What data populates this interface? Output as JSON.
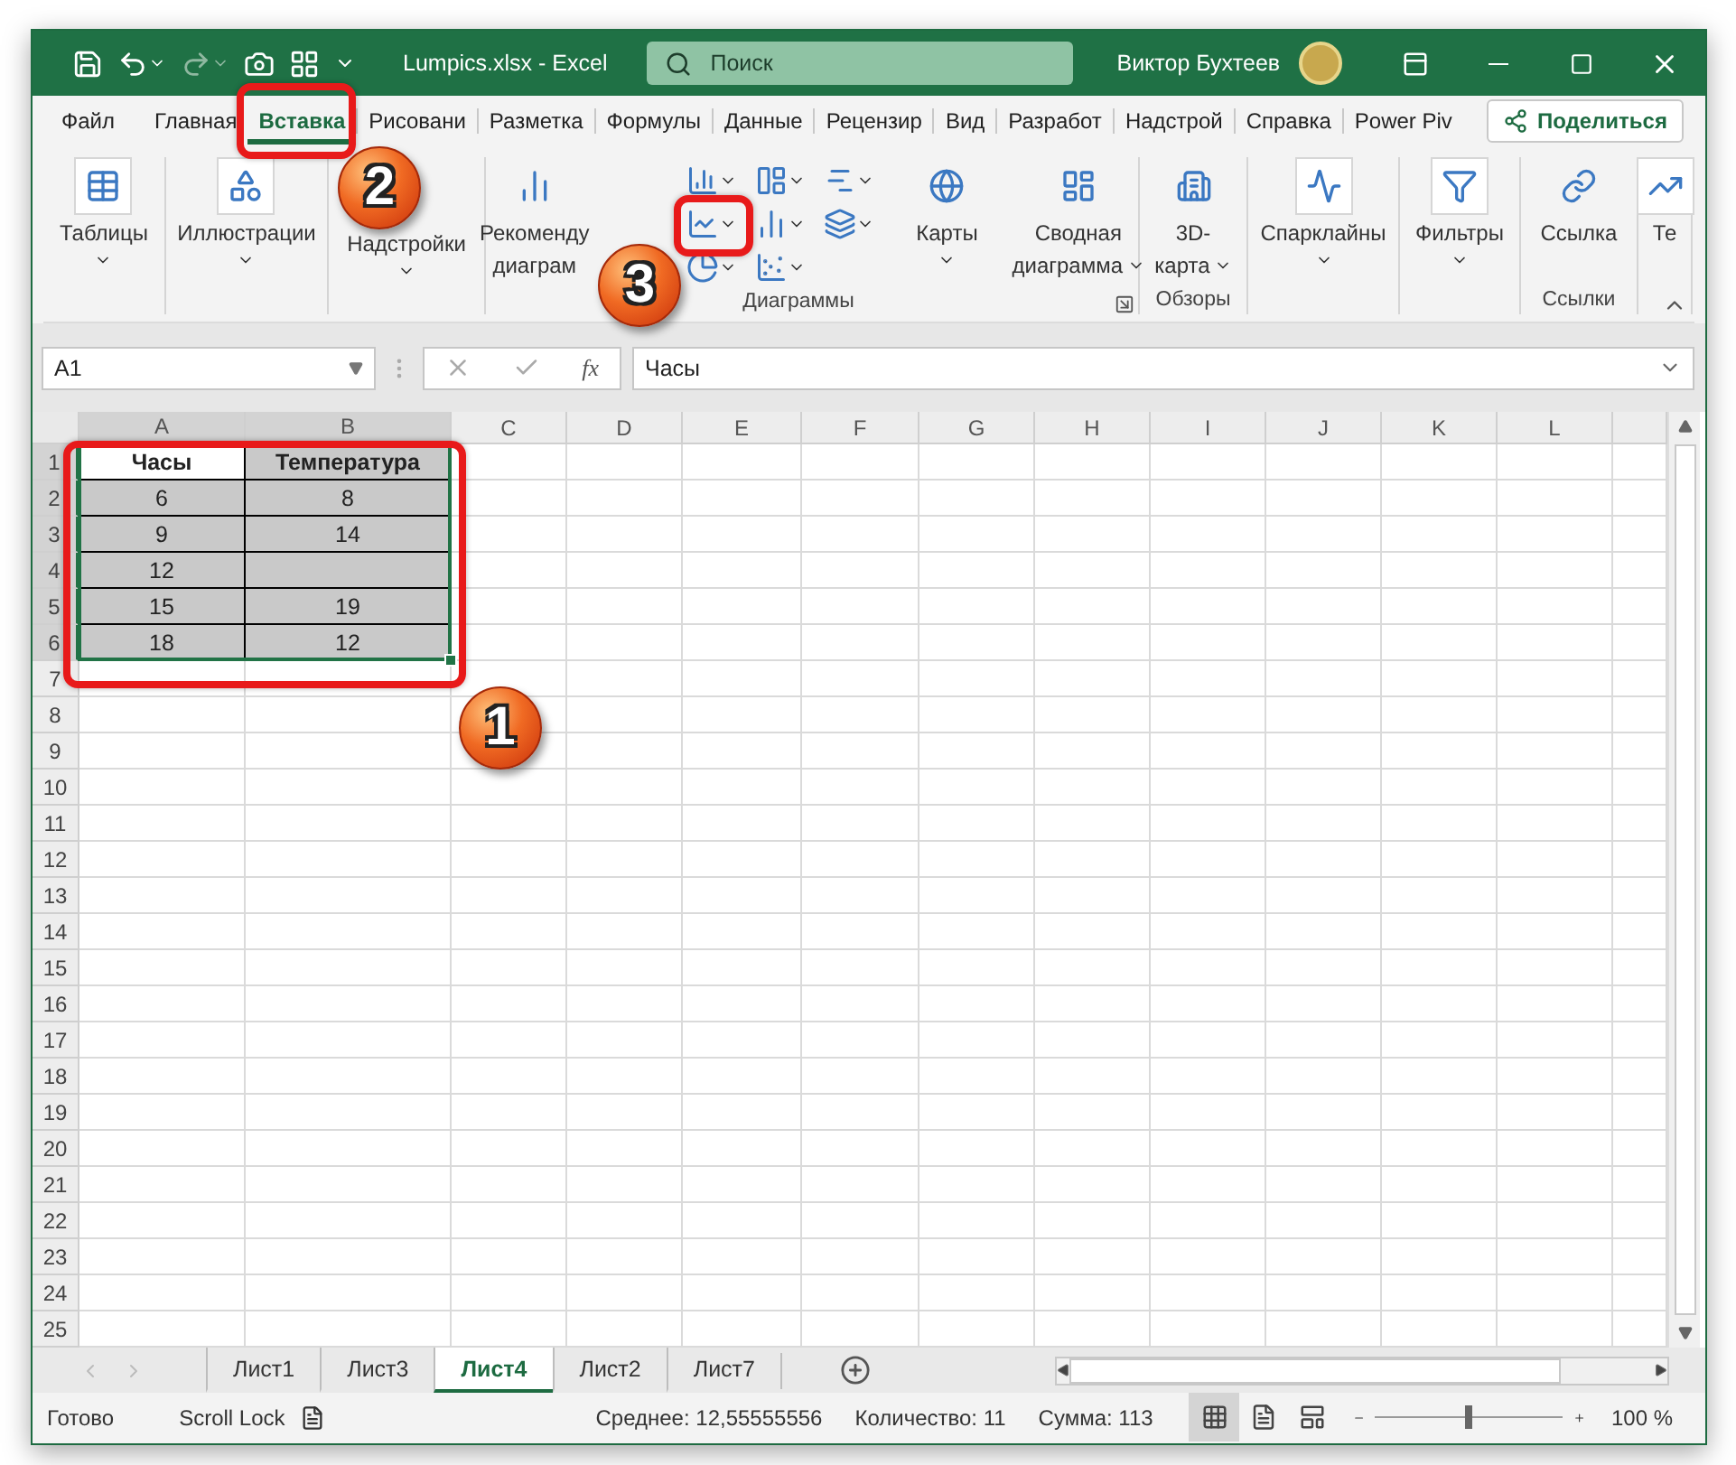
{
  "window": {
    "title": "Lumpics.xlsx  -  Excel",
    "search_placeholder": "Поиск",
    "user": "Виктор Бухтеев"
  },
  "ribbon_tabs": [
    {
      "label": "Файл",
      "selected": false
    },
    {
      "label": "Главная",
      "selected": false
    },
    {
      "label": "Вставка",
      "selected": true,
      "callout": "2"
    },
    {
      "label": "Рисовани",
      "selected": false
    },
    {
      "label": "Разметка",
      "selected": false
    },
    {
      "label": "Формулы",
      "selected": false
    },
    {
      "label": "Данные",
      "selected": false
    },
    {
      "label": "Рецензир",
      "selected": false
    },
    {
      "label": "Вид",
      "selected": false
    },
    {
      "label": "Разработ",
      "selected": false
    },
    {
      "label": "Надстрой",
      "selected": false
    },
    {
      "label": "Справка",
      "selected": false
    },
    {
      "label": "Power Piv",
      "selected": false
    }
  ],
  "share_button": "Поделиться",
  "ribbon_groups": [
    {
      "items": [
        {
          "kind": "large",
          "lines": [
            "Таблицы"
          ],
          "dropdown": true
        }
      ]
    },
    {
      "items": [
        {
          "kind": "large",
          "lines": [
            "Иллюстрации"
          ],
          "dropdown": true
        }
      ]
    },
    {
      "items": [
        {
          "kind": "large",
          "lines": [
            "Надстройки"
          ],
          "dropdown": true
        }
      ]
    },
    {
      "label": "Диаграммы",
      "launcher": true,
      "items": [
        {
          "kind": "large",
          "lines": [
            "Рекоменду",
            "диаграм"
          ],
          "dropdown": false
        },
        {
          "kind": "grid",
          "buttons": [
            {
              "dropdown": true
            },
            {
              "dropdown": true
            },
            {
              "dropdown": true
            },
            {
              "dropdown": true,
              "callout": "3"
            },
            {
              "dropdown": true
            },
            {
              "dropdown": true
            },
            {
              "dropdown": true
            },
            {
              "dropdown": true
            }
          ]
        },
        {
          "kind": "large",
          "lines": [
            "Карты"
          ],
          "dropdown": true
        },
        {
          "kind": "large",
          "lines": [
            "Сводная",
            "диаграмма"
          ],
          "dropdown": true
        }
      ]
    },
    {
      "label": "Обзоры",
      "items": [
        {
          "kind": "large",
          "lines": [
            "3D-",
            "карта"
          ],
          "dropdown": true
        }
      ]
    },
    {
      "items": [
        {
          "kind": "large",
          "lines": [
            "Спарклайны"
          ],
          "dropdown": true
        }
      ]
    },
    {
      "items": [
        {
          "kind": "large",
          "lines": [
            "Фильтры"
          ],
          "dropdown": true
        }
      ]
    },
    {
      "label": "Ссылки",
      "items": [
        {
          "kind": "large",
          "lines": [
            "Ссылка"
          ],
          "dropdown": false
        }
      ]
    },
    {
      "items": [
        {
          "kind": "large",
          "lines": [
            "Те"
          ],
          "dropdown": false
        }
      ]
    }
  ],
  "formula_bar": {
    "name_box": "A1",
    "function_label": "fx",
    "formula": "Часы"
  },
  "sheet": {
    "columns": [
      "A",
      "B",
      "C",
      "D",
      "E",
      "F",
      "G",
      "H",
      "I",
      "J",
      "K",
      "L"
    ],
    "selection_callout": "1",
    "rows": [
      {
        "number": "1",
        "header": true,
        "cells": [
          {
            "text": "Часы",
            "selected": true,
            "active": true
          },
          {
            "text": "Температура",
            "selected": true,
            "active": false
          }
        ]
      },
      {
        "number": "2",
        "cells": [
          {
            "text": "6",
            "selected": true,
            "active": false
          },
          {
            "text": "8",
            "selected": true,
            "active": false
          }
        ]
      },
      {
        "number": "3",
        "cells": [
          {
            "text": "9",
            "selected": true,
            "active": false
          },
          {
            "text": "14",
            "selected": true,
            "active": false
          }
        ]
      },
      {
        "number": "4",
        "cells": [
          {
            "text": "12",
            "selected": true,
            "active": false
          },
          {
            "selected": true,
            "active": false
          }
        ]
      },
      {
        "number": "5",
        "cells": [
          {
            "text": "15",
            "selected": true,
            "active": false
          },
          {
            "text": "19",
            "selected": true,
            "active": false
          }
        ]
      },
      {
        "number": "6",
        "cells": [
          {
            "text": "18",
            "selected": true,
            "active": false
          },
          {
            "text": "12",
            "selected": true,
            "active": false
          }
        ]
      },
      {
        "number": "7"
      },
      {
        "number": "8"
      },
      {
        "number": "9"
      },
      {
        "number": "10"
      },
      {
        "number": "11"
      },
      {
        "number": "12"
      },
      {
        "number": "13"
      },
      {
        "number": "14"
      },
      {
        "number": "15"
      },
      {
        "number": "16"
      },
      {
        "number": "17"
      },
      {
        "number": "18"
      },
      {
        "number": "19"
      },
      {
        "number": "20"
      },
      {
        "number": "21"
      },
      {
        "number": "22"
      },
      {
        "number": "23"
      },
      {
        "number": "24"
      },
      {
        "number": "25"
      }
    ]
  },
  "sheet_tabs": [
    {
      "label": "Лист1",
      "selected": false
    },
    {
      "label": "Лист3",
      "selected": false
    },
    {
      "label": "Лист4",
      "selected": true
    },
    {
      "label": "Лист2",
      "selected": false
    },
    {
      "label": "Лист7",
      "selected": false
    }
  ],
  "status_bar": {
    "mode": "Готово",
    "scroll_lock": "Scroll Lock",
    "average": "Среднее: 12,55555556",
    "count": "Количество: 11",
    "sum": "Сумма: 113",
    "views": [
      {
        "selected": true
      },
      {
        "selected": false
      },
      {
        "selected": false
      }
    ],
    "zoom": {
      "level": 0.5,
      "reading": "100 %"
    }
  }
}
